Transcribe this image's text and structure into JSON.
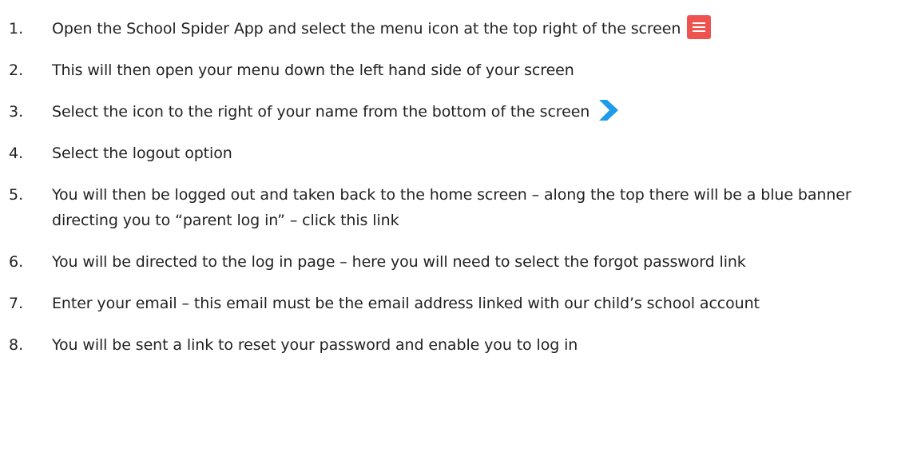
{
  "steps": [
    {
      "number": "1.",
      "text": "Open the School Spider App and select the menu icon at the top right of the screen",
      "icon": "hamburger-menu-icon"
    },
    {
      "number": "2.",
      "text": "This will then open your menu down the left hand side of your screen"
    },
    {
      "number": "3.",
      "text": "Select the icon to the right of your name from the bottom of the screen",
      "icon": "chevron-right-icon"
    },
    {
      "number": "4.",
      "text": "Select the logout option"
    },
    {
      "number": "5.",
      "text": "You will then be logged out and taken back to the home screen – along the top there will be a blue banner directing you to “parent log in” – click this link"
    },
    {
      "number": "6.",
      "text": "You will be directed to the log in page – here you will need to select the forgot password link"
    },
    {
      "number": "7.",
      "text": "Enter your email – this email must be the email address linked with our child’s school account"
    },
    {
      "number": "8.",
      "text": "You will be sent a link to reset your password and enable you to log in"
    }
  ],
  "colors": {
    "menu_icon": "#ef5350",
    "chevron_icon": "#1e9be9",
    "text": "#222222"
  }
}
